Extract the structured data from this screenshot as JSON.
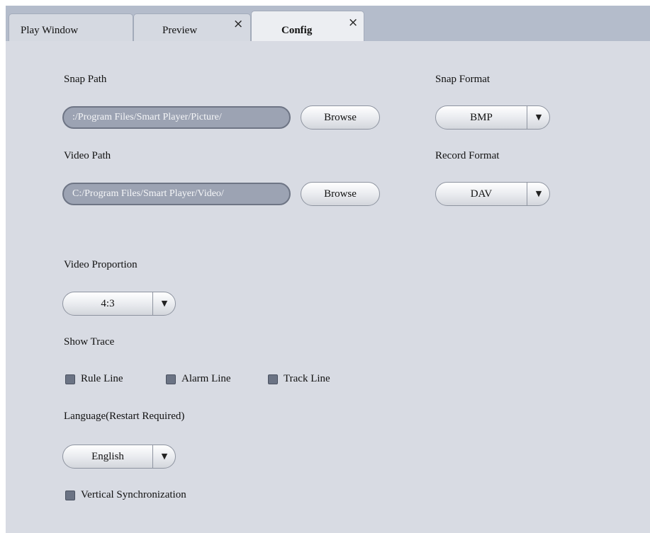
{
  "tabs": [
    {
      "label": "Play Window",
      "closable": false,
      "active": false
    },
    {
      "label": "Preview",
      "closable": true,
      "active": false,
      "close_icon": "×"
    },
    {
      "label": "Config",
      "closable": true,
      "active": true,
      "close_icon": "×"
    }
  ],
  "snap": {
    "path_label": "Snap Path",
    "path_value": ":/Program Files/Smart Player/Picture/",
    "browse_label": "Browse",
    "format_label": "Snap Format",
    "format_value": "BMP"
  },
  "video": {
    "path_label": "Video Path",
    "path_value": "C:/Program Files/Smart Player/Video/",
    "browse_label": "Browse",
    "format_label": "Record Format",
    "format_value": "DAV"
  },
  "proportion": {
    "label": "Video Proportion",
    "value": "4:3"
  },
  "trace": {
    "label": "Show Trace",
    "options": [
      {
        "label": "Rule Line",
        "checked": false
      },
      {
        "label": "Alarm Line",
        "checked": false
      },
      {
        "label": "Track Line",
        "checked": false
      }
    ]
  },
  "language": {
    "label": "Language(Restart Required)",
    "value": "English"
  },
  "vsync": {
    "label": "Vertical Synchronization",
    "checked": false
  },
  "icons": {
    "dropdown_arrow": "▼"
  },
  "colors": {
    "tabbar": "#b4bccb",
    "panel": "#d8dbe3",
    "path_field": "#9ca3b3",
    "checkbox": "#6b7384"
  }
}
